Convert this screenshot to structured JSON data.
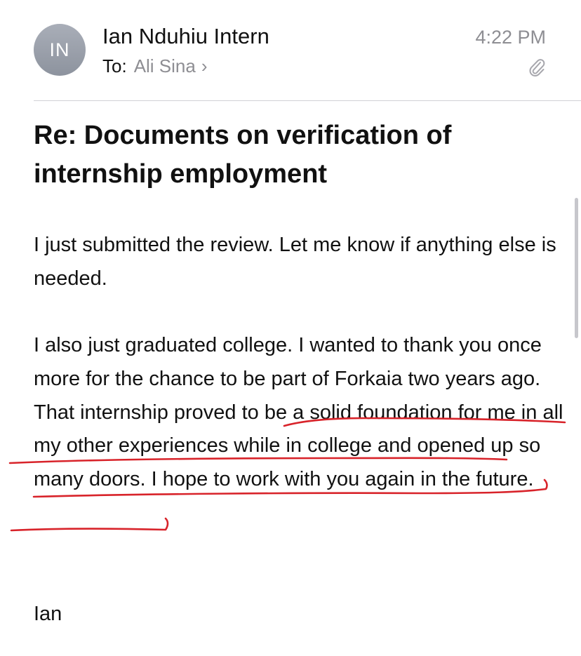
{
  "header": {
    "avatar_initials": "IN",
    "sender_name": "Ian Nduhiu Intern",
    "to_label": "To:",
    "recipient": "Ali Sina",
    "chevron": "›",
    "time": "4:22 PM",
    "attachment_icon": "paperclip-icon"
  },
  "subject": "Re: Documents on verification of internship employment",
  "body": {
    "paragraph_1": "I just submitted the review. Let me know if anything else is needed.",
    "paragraph_2": "I also just graduated college. I wanted to thank you once more for the chance to be part of Forkaia two years ago. That internship proved to be a solid foundation for me in all my other experiences while in college and opened up so many doors. I hope to work with you again in the future.",
    "signature": "Ian"
  },
  "annotation": {
    "color": "#d8232a"
  }
}
